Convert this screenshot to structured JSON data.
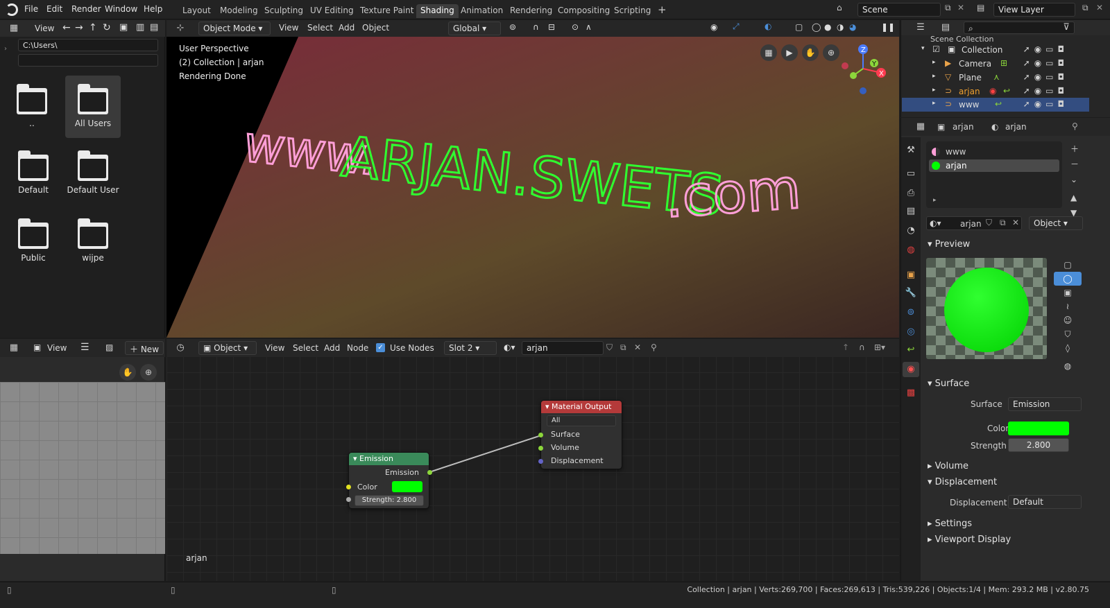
{
  "topbar": {
    "menus": [
      "File",
      "Edit",
      "Render",
      "Window",
      "Help"
    ],
    "workspaces": [
      "Layout",
      "Modeling",
      "Sculpting",
      "UV Editing",
      "Texture Paint",
      "Shading",
      "Animation",
      "Rendering",
      "Compositing",
      "Scripting"
    ],
    "active_workspace": "Shading",
    "scene_name": "Scene",
    "view_layer": "View Layer"
  },
  "file_browser": {
    "view_label": "View",
    "path": "C:\\Users\\",
    "filter": "",
    "items": [
      "..",
      "All Users",
      "Default",
      "Default User",
      "Public",
      "wijpe"
    ]
  },
  "viewport": {
    "mode": "Object Mode",
    "menus": [
      "View",
      "Select",
      "Add",
      "Object"
    ],
    "transform": "Global",
    "overlay_lines": [
      "User Perspective",
      "(2) Collection | arjan",
      "Rendering Done"
    ],
    "scene_text": "www.ARJAN.SWETS.com"
  },
  "outliner": {
    "header": "Scene Collection",
    "rows": [
      {
        "label": "Collection",
        "name": "collection"
      },
      {
        "label": "Camera",
        "name": "camera"
      },
      {
        "label": "Plane",
        "name": "plane"
      },
      {
        "label": "arjan",
        "name": "arjan"
      },
      {
        "label": "www",
        "name": "www"
      }
    ]
  },
  "properties": {
    "object_name": "arjan",
    "material_name": "arjan",
    "slots": [
      "www",
      "arjan"
    ],
    "material_field": "arjan",
    "link": "Object",
    "sections": {
      "preview": "Preview",
      "surface": "Surface",
      "volume": "Volume",
      "displacement": "Displacement",
      "settings": "Settings",
      "viewport_display": "Viewport Display"
    },
    "surface_label": "Surface",
    "surface_value": "Emission",
    "color_label": "Color",
    "strength_label": "Strength",
    "strength_value": "2.800",
    "displacement_label": "Displacement",
    "displacement_value": "Default",
    "accent_color": "#00ff00"
  },
  "image_editor": {
    "view_label": "View",
    "new_label": "New"
  },
  "node_editor": {
    "object_dropdown": "Object",
    "menus": [
      "View",
      "Select",
      "Add",
      "Node"
    ],
    "use_nodes": "Use Nodes",
    "slot": "Slot 2",
    "material": "arjan",
    "footer_label": "arjan",
    "emission_node": {
      "title": "Emission",
      "output": "Emission",
      "color": "Color",
      "strength": "Strength:  2.800"
    },
    "output_node": {
      "title": "Material Output",
      "target": "All",
      "inputs": [
        "Surface",
        "Volume",
        "Displacement"
      ]
    }
  },
  "statusbar": {
    "text": "Collection | arjan | Verts:269,700 | Faces:269,613 | Tris:539,226 | Objects:1/4 | Mem: 293.2 MB | v2.80.75"
  }
}
